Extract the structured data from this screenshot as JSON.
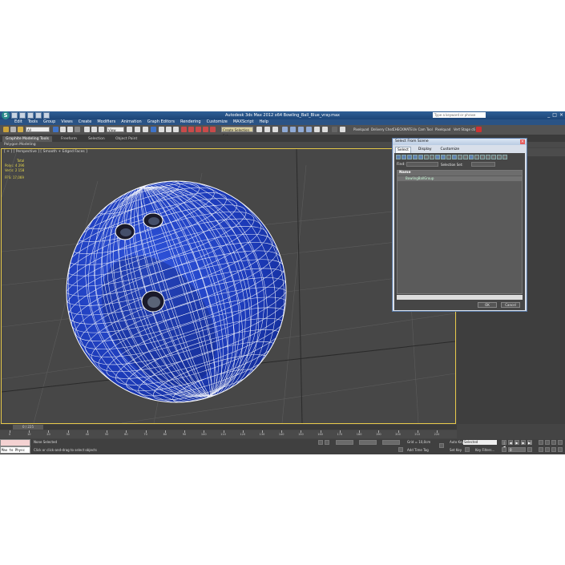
{
  "app": {
    "title": "Autodesk 3ds Max 2012 x64     Bowling_Ball_Blue_vray.max",
    "search_placeholder": "Type a keyword or phrase",
    "logo": "S",
    "window_controls": [
      "_",
      "□",
      "×"
    ]
  },
  "menu": [
    "Edit",
    "Tools",
    "Group",
    "Views",
    "Create",
    "Modifiers",
    "Animation",
    "Graph Editors",
    "Rendering",
    "Customize",
    "MAXScript",
    "Help"
  ],
  "toolbar": {
    "filter_dropdown": "All",
    "view_dropdown": "View",
    "selection_set": "Create Selection Set",
    "extras": [
      "Pixelquad",
      "Delivery Chsd",
      "CHECKMATE",
      "Uv Cam Tool",
      "Pixelquad",
      "Vert Stage c6"
    ]
  },
  "ribbon": {
    "tabs": [
      "Graphite Modeling Tools",
      "Freeform",
      "Selection",
      "Object Paint"
    ],
    "sub_label": "Polygon Modeling"
  },
  "viewport": {
    "label": "[ + ] [ Perspective ] [ Smooth + Edged Faces ]",
    "stats_total_label": "Total",
    "stats_polys_label": "Polys:",
    "stats_polys": "4 296",
    "stats_verts_label": "Verts:",
    "stats_verts": "2 158",
    "stats_fps_label": "FPS:",
    "stats_fps": "17,069",
    "colors": {
      "ball": "#1f3fb8",
      "wire": "#ffffff",
      "grid": "#5a5a5a",
      "bg": "#474747"
    }
  },
  "timeline": {
    "slider": "0 / 225",
    "ticks": [
      "0",
      "10",
      "20",
      "30",
      "40",
      "50",
      "60",
      "70",
      "80",
      "90",
      "100",
      "110",
      "120",
      "130",
      "140",
      "150",
      "160",
      "170",
      "180",
      "190",
      "200",
      "210",
      "220"
    ]
  },
  "status": {
    "maxscript_text": "Max to Physc",
    "selection": "None Selected",
    "prompt": "Click or click-and-drag to select objects",
    "grid": "Grid = 10,0cm",
    "add_time_tag": "Add Time Tag",
    "auto_key": "Auto Key",
    "auto_key_value": "Selected",
    "set_key": "Set Key",
    "key_filters": "Key Filters...",
    "frame": "0"
  },
  "dialog": {
    "title": "Select From Scene",
    "close": "×",
    "tabs": [
      "Select",
      "Display",
      "Customize"
    ],
    "find_label": "Find:",
    "selection_set_label": "Selection Set:",
    "column_name": "Name",
    "items": [
      "BowlingBallGroup"
    ],
    "ok": "OK",
    "cancel": "Cancel"
  }
}
